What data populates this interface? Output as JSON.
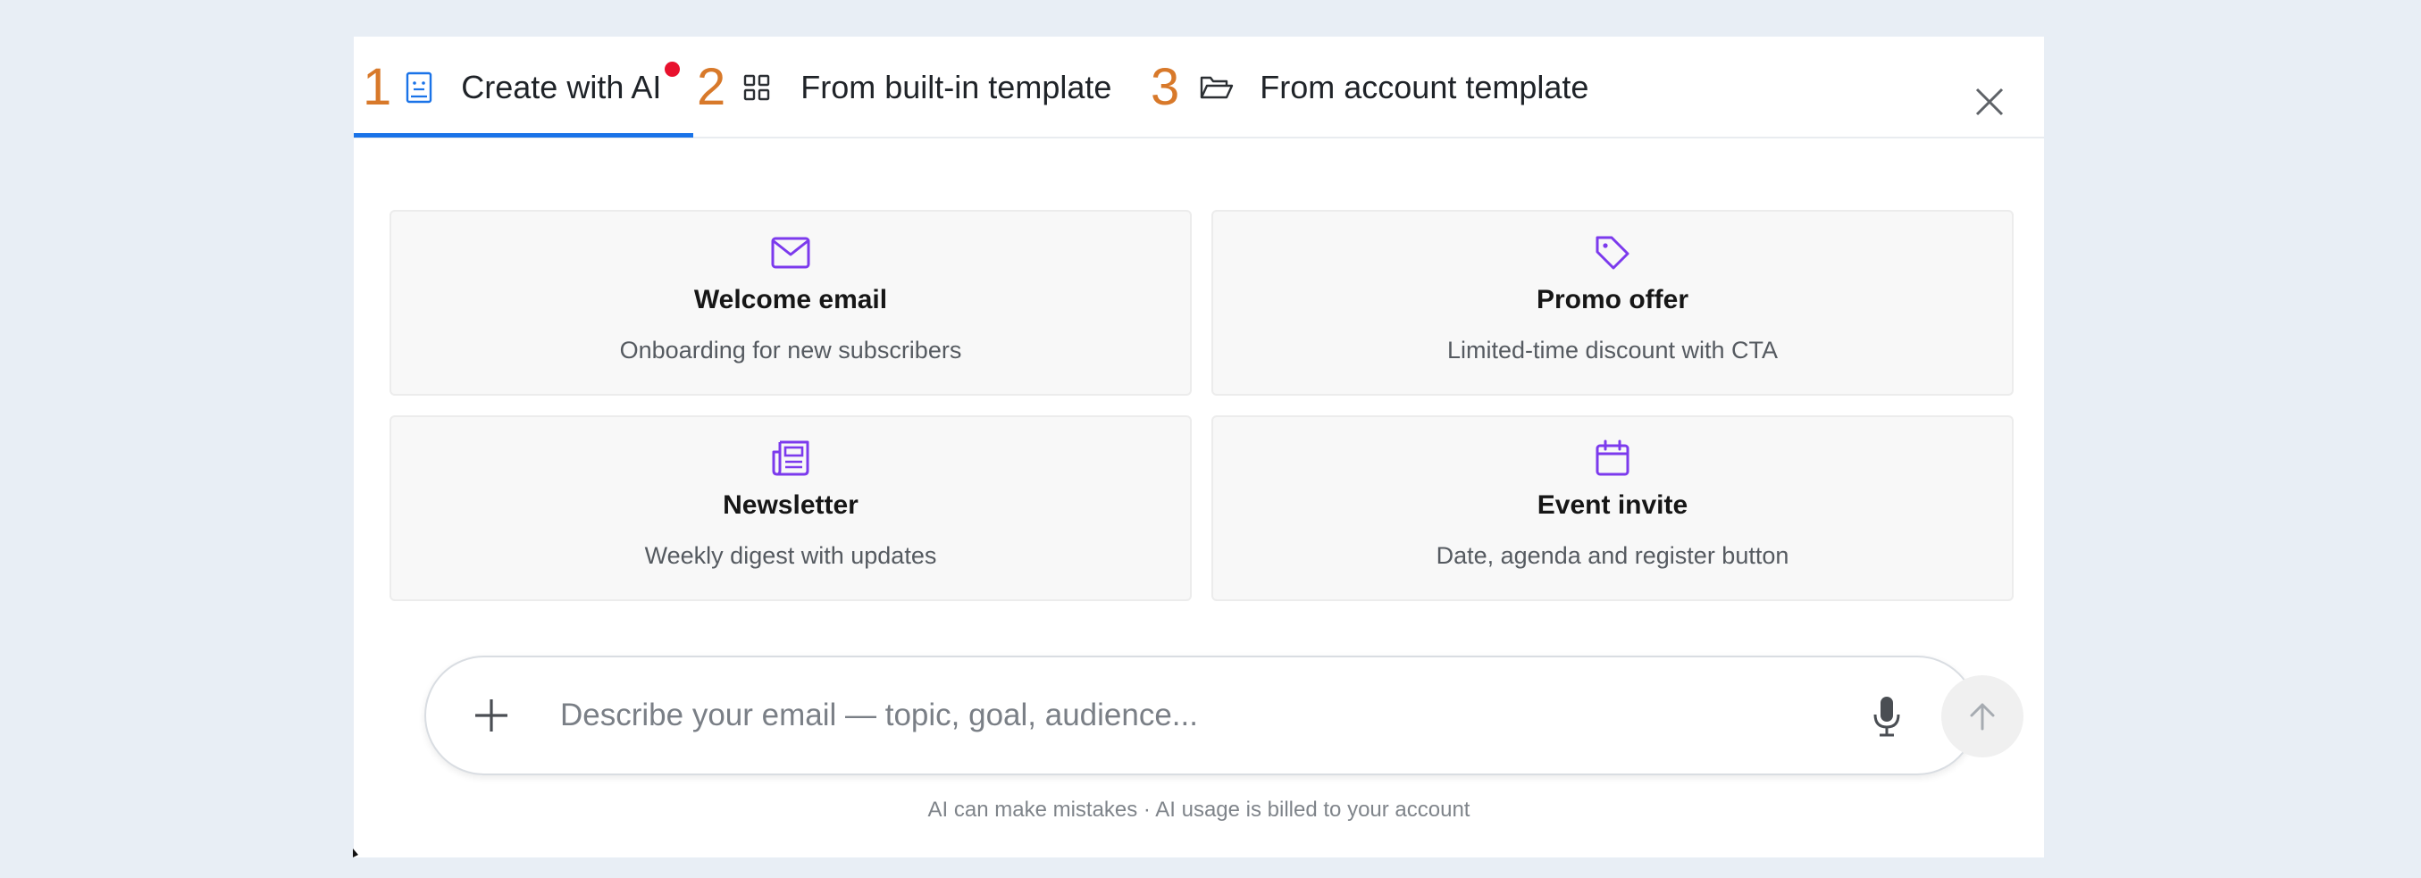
{
  "tabs": [
    {
      "num": "1",
      "label": "Create with AI",
      "icon": "ai-template-icon",
      "active": true,
      "has_dot": true
    },
    {
      "num": "2",
      "label": "From built-in template",
      "icon": "grid-icon",
      "active": false
    },
    {
      "num": "3",
      "label": "From account template",
      "icon": "folder-open-icon",
      "active": false
    }
  ],
  "cards": [
    {
      "icon": "envelope-icon",
      "title": "Welcome email",
      "subtitle": "Onboarding for new subscribers"
    },
    {
      "icon": "tag-icon",
      "title": "Promo offer",
      "subtitle": "Limited-time discount with CTA"
    },
    {
      "icon": "newspaper-icon",
      "title": "Newsletter",
      "subtitle": "Weekly digest with updates"
    },
    {
      "icon": "calendar-icon",
      "title": "Event invite",
      "subtitle": "Date, agenda and register button"
    }
  ],
  "composer": {
    "placeholder": "Describe your email — topic, goal, audience...",
    "value": ""
  },
  "disclaimer": "AI can make mistakes · AI usage is billed to your account",
  "colors": {
    "accent": "#1a73e8",
    "card_icon": "#7c3aed",
    "tab_number": "#d8792a",
    "notification_dot": "#e8112d",
    "page_background": "#e8eef5"
  }
}
